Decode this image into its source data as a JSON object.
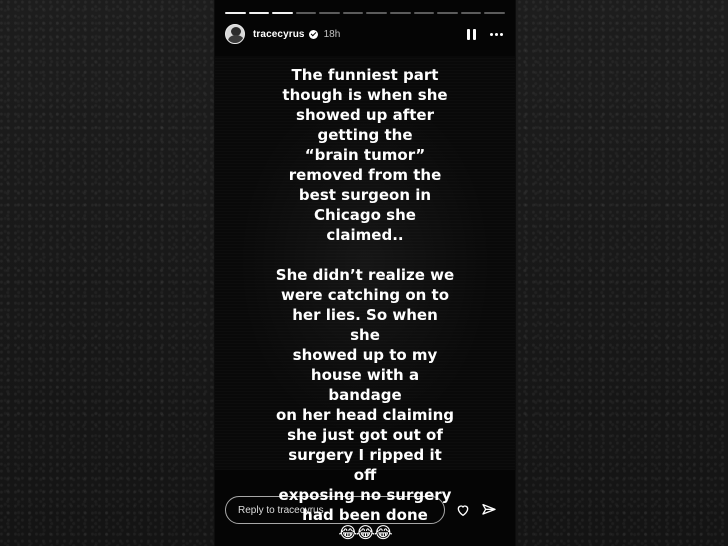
{
  "story": {
    "username": "tracecyrus",
    "time": "18h",
    "caption_para1": "The funniest part\nthough is when she\nshowed up after\ngetting the\n“brain tumor”\nremoved  from the\nbest surgeon in\nChicago she claimed..",
    "caption_para2": "She didn’t realize we\nwere catching on to\nher lies. So when she\nshowed up to my\nhouse with a bandage\non her head claiming\nshe just got out of\nsurgery I ripped it off\nexposing no surgery\nhad been done",
    "emoji": "😂😂😂"
  },
  "reply": {
    "placeholder": "Reply to tracecyrus..."
  },
  "icons": {
    "avatar": "avatar",
    "verified": "verified-icon",
    "pause": "pause-icon",
    "more": "more-icon",
    "heart": "heart-icon",
    "send": "send-icon"
  },
  "colors": {
    "background": "#141414",
    "story": "#050505",
    "text": "#ffffff"
  }
}
